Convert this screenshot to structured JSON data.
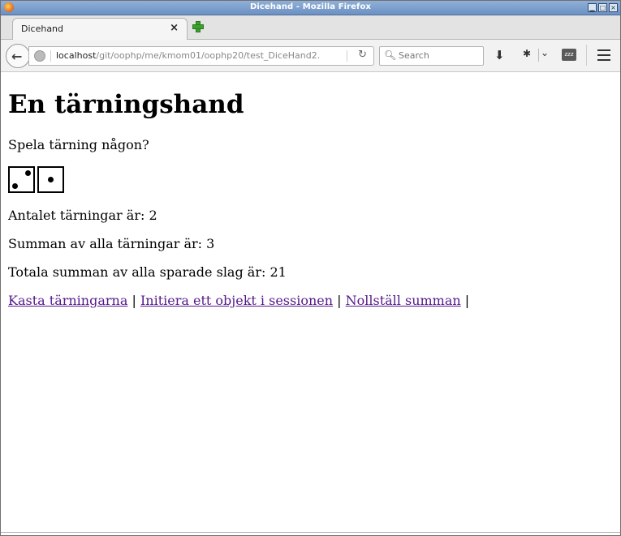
{
  "window": {
    "title": "Dicehand - Mozilla Firefox",
    "controls": {
      "minimize": "▁",
      "maximize": "□",
      "close": "×"
    }
  },
  "tabs": [
    {
      "label": "Dicehand",
      "close": "×"
    }
  ],
  "navbar": {
    "url_host": "localhost",
    "url_path": "/git/oophp/me/kmom01/oophp20/test_DiceHand2.",
    "search_placeholder": "Search",
    "icons": [
      "back-arrow-icon",
      "globe-icon",
      "reload-icon",
      "search-icon",
      "download-icon",
      "extension-icon",
      "chevron-down-icon",
      "zzz-icon",
      "hamburger-menu-icon"
    ]
  },
  "page": {
    "heading": "En tärningshand",
    "intro": "Spela tärning någon?",
    "dice": [
      2,
      1
    ],
    "count_text": "Antalet tärningar är: 2",
    "sum_text": "Summan av alla tärningar är: 3",
    "total_text": "Totala summan av alla sparade slag är: 21",
    "links": [
      {
        "label": "Kasta tärningarna"
      },
      {
        "label": "Initiera ett objekt i sessionen"
      },
      {
        "label": "Nollställ summan"
      }
    ],
    "separator": "|",
    "link_color": "#551a8b"
  }
}
